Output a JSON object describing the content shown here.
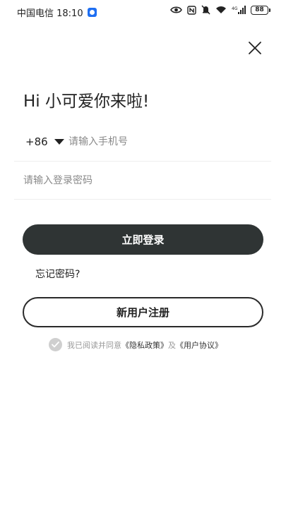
{
  "status_bar": {
    "carrier_time": "中国电信 18:10",
    "battery": "88",
    "icons": [
      "app-notification-icon",
      "eye-icon",
      "nfc-icon",
      "mute-bell-icon",
      "wifi-icon",
      "signal-4g-icon",
      "battery-icon"
    ]
  },
  "login": {
    "greeting": "Hi 小可爱你来啦!",
    "country_code": "+86",
    "phone_placeholder": "请输入手机号",
    "password_placeholder": "请输入登录密码",
    "login_button": "立即登录",
    "forgot_password": "忘记密码?",
    "register_button": "新用户注册",
    "agreement": {
      "prefix": "我已阅读并同意",
      "privacy_link": "《隐私政策》",
      "and": "及",
      "user_link": "《用户协议》"
    }
  },
  "colors": {
    "primary_button": "#2f3434",
    "placeholder": "#8a8a8a",
    "divider": "#eeeeee",
    "check_inactive": "#cfcfcf"
  }
}
